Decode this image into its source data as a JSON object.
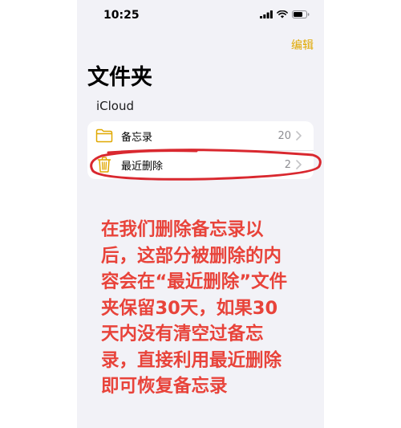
{
  "status_bar": {
    "time": "10:25",
    "icons": [
      "signal-icon",
      "wifi-icon",
      "battery-icon"
    ]
  },
  "nav": {
    "edit_label": "编辑",
    "accent_color": "#e0a800"
  },
  "page_title": "文件夹",
  "section": {
    "title": "iCloud",
    "folders": [
      {
        "label": "备忘录",
        "count": "20",
        "icon": "folder-icon"
      },
      {
        "label": "最近删除",
        "count": "2",
        "icon": "trash-icon"
      }
    ]
  },
  "annotation": {
    "color": "#e8433a",
    "lines": [
      "在我们删除备忘录以",
      "后，这部分被删除的内",
      "容会在“最近删除”文件",
      "夹保留30天，如果30",
      "天内没有清空过备忘",
      "录，直接利用最近删除",
      "即可恢复备忘录"
    ]
  }
}
